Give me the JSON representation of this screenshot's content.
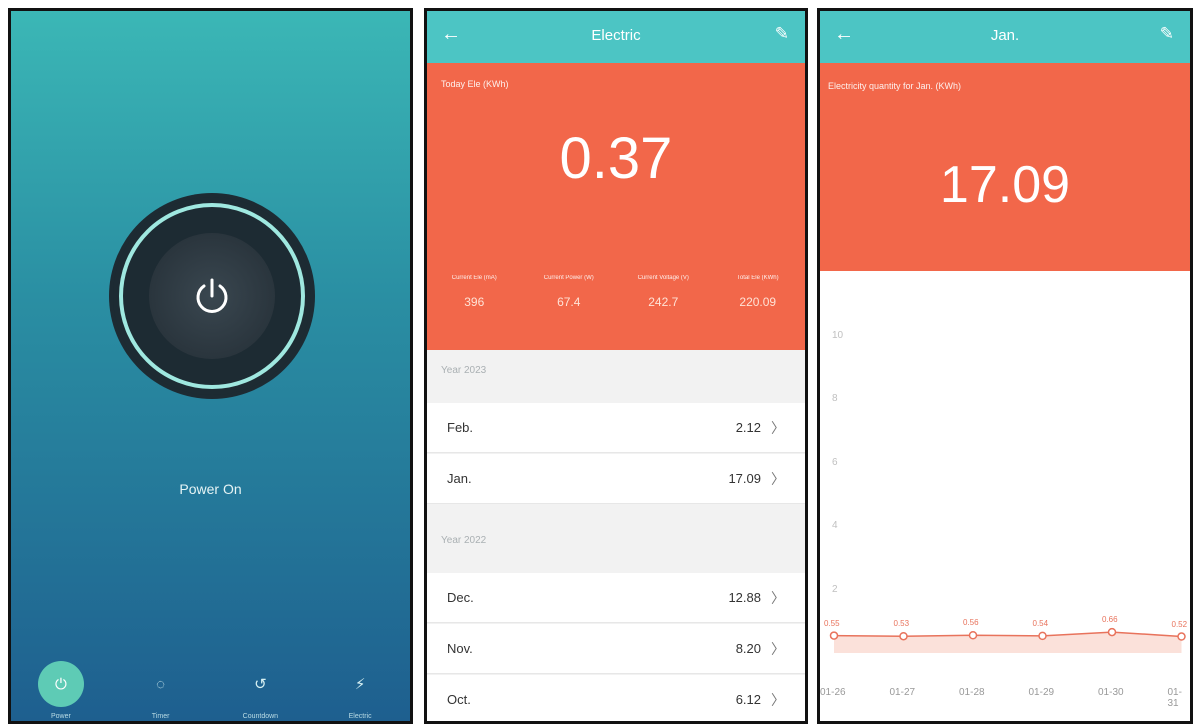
{
  "power_screen": {
    "status_label": "Power On",
    "tabs": [
      {
        "label": "Power",
        "icon": "power-icon",
        "active": true
      },
      {
        "label": "Timer",
        "icon": "timer-icon",
        "active": false
      },
      {
        "label": "Countdown",
        "icon": "countdown-icon",
        "active": false
      },
      {
        "label": "Electric",
        "icon": "bolt-icon",
        "active": false
      }
    ]
  },
  "electric_screen": {
    "header": {
      "back_icon": "back-arrow-icon",
      "title": "Electric",
      "edit_icon": "edit-icon"
    },
    "today_caption": "Today Ele (KWh)",
    "today_value": "0.37",
    "stats": [
      {
        "label": "Current Ele (mA)",
        "value": "396"
      },
      {
        "label": "Current Power (W)",
        "value": "67.4"
      },
      {
        "label": "Current Voltage (V)",
        "value": "242.7"
      },
      {
        "label": "Total Ele (KWh)",
        "value": "220.09"
      }
    ],
    "groups": [
      {
        "year": "Year 2023",
        "months": [
          {
            "month": "Feb.",
            "value": "2.12"
          },
          {
            "month": "Jan.",
            "value": "17.09"
          }
        ]
      },
      {
        "year": "Year 2022",
        "months": [
          {
            "month": "Dec.",
            "value": "12.88"
          },
          {
            "month": "Nov.",
            "value": "8.20"
          },
          {
            "month": "Oct.",
            "value": "6.12"
          }
        ]
      }
    ]
  },
  "month_screen": {
    "header": {
      "back_icon": "back-arrow-icon",
      "title": "Jan.",
      "edit_icon": "edit-icon"
    },
    "caption": "Electricity quantity for Jan. (KWh)",
    "value": "17.09"
  },
  "chart_data": {
    "type": "area",
    "categories": [
      "01-26",
      "01-27",
      "01-28",
      "01-29",
      "01-30",
      "01-31"
    ],
    "series": [
      {
        "values": [
          0.55,
          0.53,
          0.56,
          0.54,
          0.66,
          0.52
        ]
      }
    ],
    "data_labels": [
      "0.55",
      "0.53",
      "0.56",
      "0.54",
      "0.66",
      "0.52"
    ],
    "y_ticks": [
      "10",
      "8",
      "6",
      "4",
      "2"
    ],
    "ylim": [
      0,
      10
    ],
    "color": "#e8735c",
    "grid": false
  },
  "colors": {
    "accent": "#4cc5c4",
    "header_red": "#f2674a",
    "power_active": "#5ecbb5"
  }
}
